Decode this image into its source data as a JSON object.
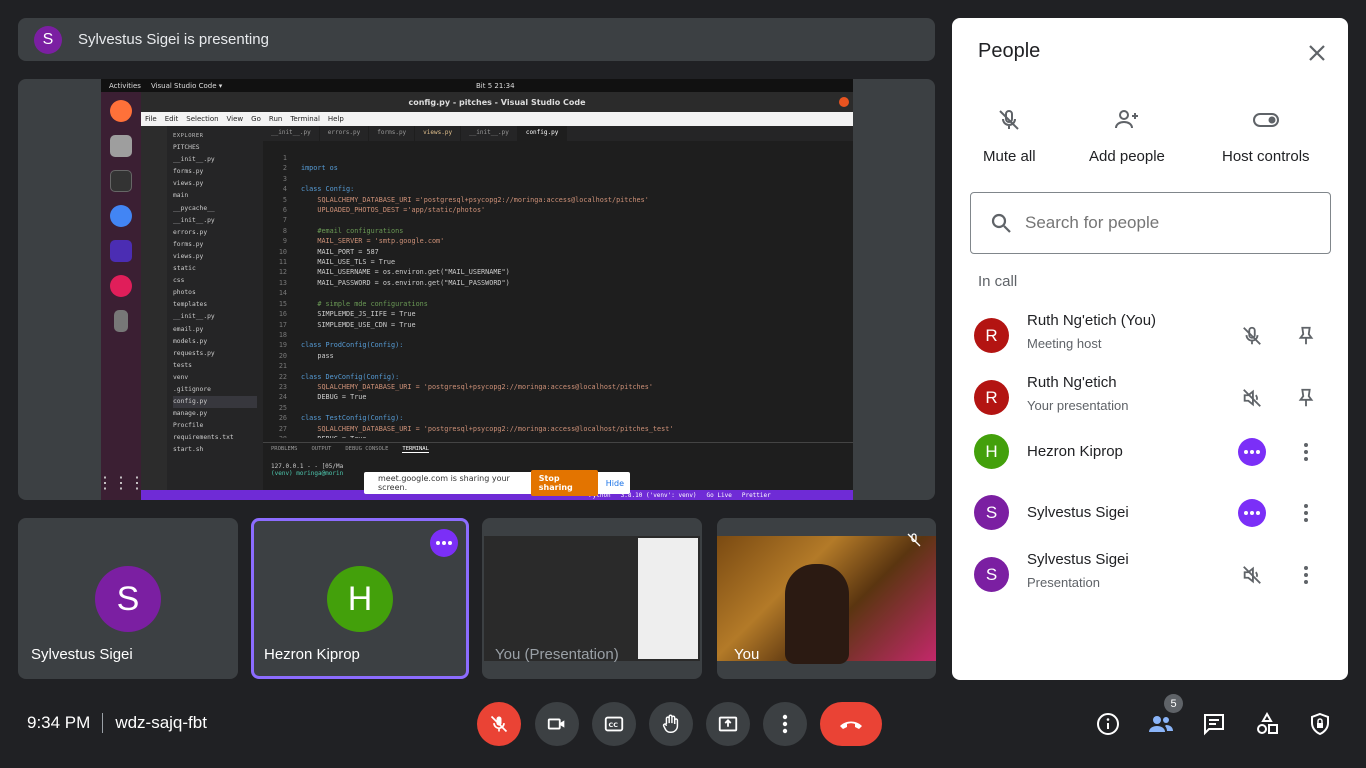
{
  "banner": {
    "avatar_letter": "S",
    "text": "Sylvestus Sigei is presenting"
  },
  "shared_screen": {
    "topbar_activities": "Activities",
    "topbar_app": "Visual Studio Code ▾",
    "topbar_clock": "Bit 5  21:34",
    "window_title": "config.py - pitches - Visual Studio Code",
    "menu": [
      "File",
      "Edit",
      "Selection",
      "View",
      "Go",
      "Run",
      "Terminal",
      "Help"
    ],
    "tabs": [
      "__init__.py",
      "errors.py",
      "forms.py",
      "views.py",
      "__init__.py",
      "config.py"
    ],
    "explorer_header": "EXPLORER",
    "explorer_items": [
      "PITCHES",
      "__init__.py",
      "forms.py",
      "views.py",
      "main",
      "__pycache__",
      "__init__.py",
      "errors.py",
      "forms.py",
      "views.py",
      "static",
      "css",
      "photos",
      "templates",
      "__init__.py",
      "email.py",
      "models.py",
      "requests.py",
      "tests",
      "venv",
      ".gitignore",
      "config.py",
      "manage.py",
      "Procfile",
      "requirements.txt",
      "start.sh"
    ],
    "code_lines": [
      "",
      "import os",
      "",
      "class Config:",
      "    SQLALCHEMY_DATABASE_URI ='postgresql+psycopg2://moringa:access@localhost/pitches'",
      "    UPLOADED_PHOTOS_DEST ='app/static/photos'",
      "",
      "    #email configurations",
      "    MAIL_SERVER = 'smtp.google.com'",
      "    MAIL_PORT = 587",
      "    MAIL_USE_TLS = True",
      "    MAIL_USERNAME = os.environ.get(\"MAIL_USERNAME\")",
      "    MAIL_PASSWORD = os.environ.get(\"MAIL_PASSWORD\")",
      "",
      "    # simple mde configurations",
      "    SIMPLEMDE_JS_IIFE = True",
      "    SIMPLEMDE_USE_CDN = True",
      "",
      "class ProdConfig(Config):",
      "    pass",
      "",
      "class DevConfig(Config):",
      "    SQLALCHEMY_DATABASE_URI = 'postgresql+psycopg2://moringa:access@localhost/pitches'",
      "    DEBUG = True",
      "",
      "class TestConfig(Config):",
      "    SQLALCHEMY_DATABASE_URI = 'postgresql+psycopg2://moringa:access@localhost/pitches_test'",
      "    DEBUG = True"
    ],
    "terminal_tabs": [
      "PROBLEMS",
      "OUTPUT",
      "DEBUG CONSOLE",
      "TERMINAL"
    ],
    "terminal_line1": "127.0.0.1 - - [05/Ma",
    "terminal_line2": "(venv) moringa@morin",
    "share_bar_text": "meet.google.com is sharing your screen.",
    "share_stop": "Stop sharing",
    "share_hide": "Hide",
    "statusbar": [
      "Python",
      "3.8.10 ('venv': venv)",
      "Go Live",
      "Prettier"
    ]
  },
  "tiles": [
    {
      "name": "Sylvestus Sigei",
      "letter": "S",
      "color": "#7b1fa2"
    },
    {
      "name": "Hezron Kiprop",
      "letter": "H",
      "color": "#43a00b"
    },
    {
      "name": "You (Presentation)"
    },
    {
      "name": "You"
    }
  ],
  "bottom": {
    "time": "9:34 PM",
    "meeting_code": "wdz-sajq-fbt",
    "participant_count": "5"
  },
  "people_panel": {
    "title": "People",
    "actions": {
      "mute_all": "Mute all",
      "add_people": "Add people",
      "host_controls": "Host controls"
    },
    "search_placeholder": "Search for people",
    "section": "In call",
    "people": [
      {
        "letter": "R",
        "name": "Ruth Ng'etich (You)",
        "sub": "Meeting host",
        "color": "#b31412"
      },
      {
        "letter": "R",
        "name": "Ruth Ng'etich",
        "sub": "Your presentation",
        "color": "#b31412"
      },
      {
        "letter": "H",
        "name": "Hezron Kiprop",
        "sub": "",
        "color": "#43a00b"
      },
      {
        "letter": "S",
        "name": "Sylvestus Sigei",
        "sub": "",
        "color": "#7b1fa2"
      },
      {
        "letter": "S",
        "name": "Sylvestus Sigei",
        "sub": "Presentation",
        "color": "#7b1fa2"
      }
    ]
  },
  "colors": {
    "accent": "#7b2ff7",
    "danger": "#ea4335",
    "bg": "#202124",
    "tile": "#3c4043"
  }
}
